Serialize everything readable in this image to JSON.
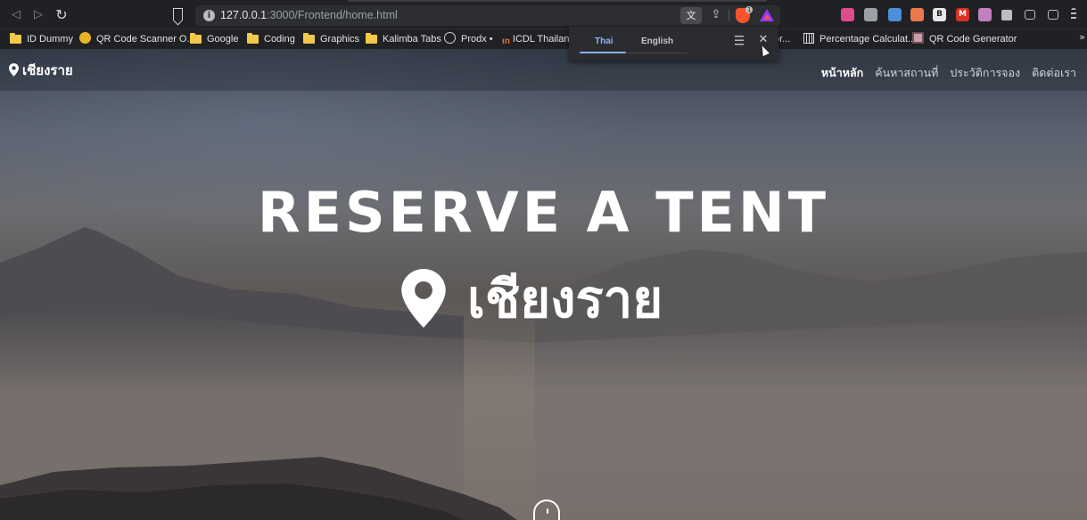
{
  "browser": {
    "url_host": "127.0.0.1",
    "url_path": ":3000/Frontend/home.html",
    "nav": {
      "back_icon": "back-arrow-icon",
      "forward_icon": "forward-arrow-icon",
      "reload_icon": "reload-icon"
    },
    "brave_badge": "1",
    "extensions": [
      {
        "name": "color-ext-icon",
        "text": "",
        "color": "#e04a8f"
      },
      {
        "name": "vpn-ext-icon",
        "text": "",
        "color": "#9aa0a6"
      },
      {
        "name": "calendar-ext-icon",
        "text": "",
        "color": "#4d8fd8"
      },
      {
        "name": "scanner-ext-icon",
        "text": "",
        "color": "#e9794b"
      },
      {
        "name": "b-ext-icon",
        "text": "B",
        "color": "#e8e8e8"
      },
      {
        "name": "gmail-ext-icon",
        "text": "M",
        "color": "#d93025"
      },
      {
        "name": "photo-ext-icon",
        "text": "",
        "color": "#c07fbf"
      },
      {
        "name": "puzzle-extensions-icon",
        "text": "",
        "color": "#bdbdbd"
      },
      {
        "name": "sidebar-icon",
        "text": "",
        "color": "#bdbdbd"
      },
      {
        "name": "wallet-icon",
        "text": "",
        "color": "#bdbdbd"
      },
      {
        "name": "menu-icon",
        "text": "",
        "color": "#bdbdbd"
      }
    ]
  },
  "bookmarks": [
    {
      "label": "ID Dummy",
      "icon": "folder"
    },
    {
      "label": "QR Code Scanner O...",
      "icon": "coin",
      "color": "#e8b526"
    },
    {
      "label": "Google",
      "icon": "folder"
    },
    {
      "label": "Coding",
      "icon": "folder"
    },
    {
      "label": "Graphics",
      "icon": "folder"
    },
    {
      "label": "Kalimba Tabs",
      "icon": "folder"
    },
    {
      "label": "Prodx •",
      "icon": "globe"
    },
    {
      "label": "ICDL Thailand",
      "icon": "icdl",
      "color": "#e8732b"
    },
    {
      "label": "or...",
      "icon": "none"
    },
    {
      "label": "Percentage Calculat...",
      "icon": "calc"
    },
    {
      "label": "QR Code Generator",
      "icon": "qr"
    }
  ],
  "bookmarks_more": "»",
  "translate_popup": {
    "active_tab": "Thai",
    "other_tab": "English",
    "close": "✕"
  },
  "site": {
    "logo_text": "เชียงราย",
    "nav_links": [
      "หน้าหลัก",
      "ค้นหาสถานที่",
      "ประวัติการจอง",
      "ติดต่อเรา"
    ],
    "active_link": 0,
    "hero_title": "RESERVE A TENT",
    "hero_city": "เชียงราย"
  }
}
